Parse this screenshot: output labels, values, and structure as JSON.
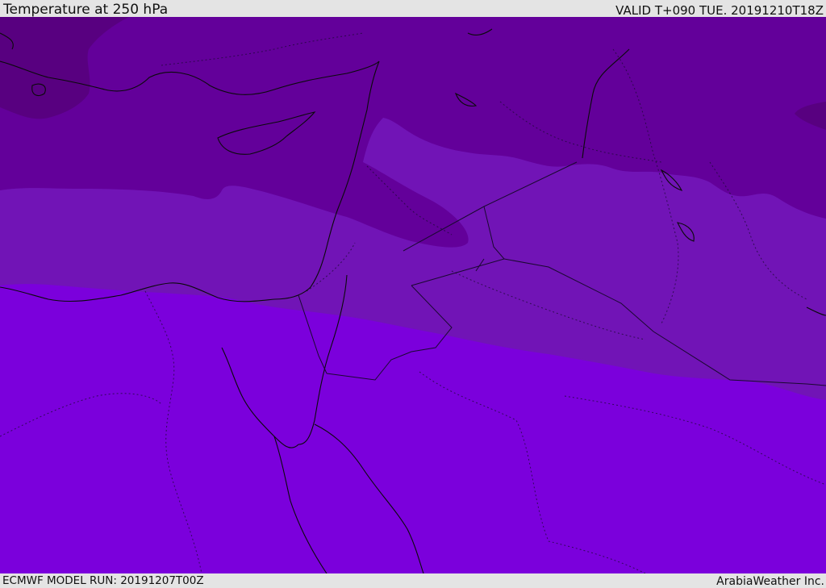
{
  "header": {
    "title": "Temperature at 250 hPa",
    "valid": "VALID T+090 TUE. 20191210T18Z"
  },
  "footer": {
    "model_run": "ECMWF MODEL RUN: 20191207T00Z",
    "credit": "ArabiaWeather Inc."
  },
  "map": {
    "colors": {
      "coldest": "#580080",
      "cold": "#63009a",
      "mid": "#7114b6",
      "warm": "#7b00dc",
      "coast_line": "#0a0a0a"
    }
  }
}
